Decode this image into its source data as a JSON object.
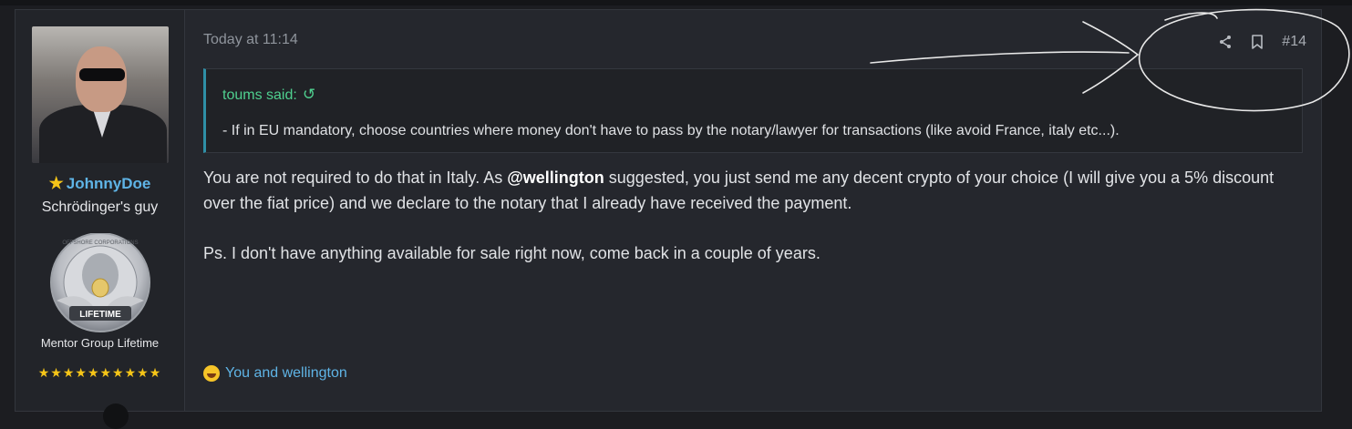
{
  "post": {
    "time": "Today at 11:14",
    "number": "#14",
    "author": {
      "username": "JohnnyDoe",
      "title": "Schrödinger's guy",
      "rank": "Mentor Group Lifetime",
      "rank_stars": "★★★★★★★★★★",
      "badge_text": "LIFETIME",
      "badge_ring_text": "OFFSHORE CORPORATIONS"
    },
    "quote": {
      "author": "toums said:",
      "text": "- If in EU mandatory, choose countries where money don't have to pass by the notary/lawyer for transactions (like avoid France, italy etc...)."
    },
    "body": {
      "p1_before": "You are not required to do that in Italy. As ",
      "mention": "@wellington",
      "p1_after": " suggested, you just send me any decent crypto of your choice (I will give you a 5% discount over the fiat price) and we declare to the notary that I already have received the payment.",
      "p2": "Ps. I don't have anything available for sale right now, come back in a couple of years."
    },
    "reactions": "You and wellington"
  },
  "colors": {
    "accent_link": "#5fb4e6",
    "quote_author": "#4fd08f",
    "star": "#f5c518"
  }
}
